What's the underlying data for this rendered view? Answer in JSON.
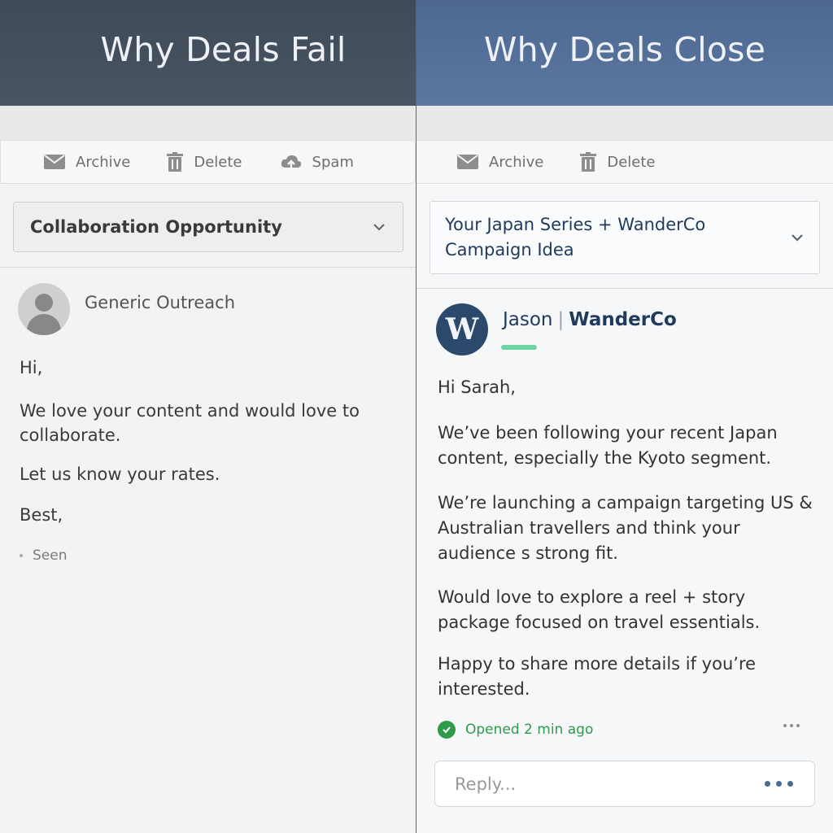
{
  "left": {
    "banner_title": "Why Deals Fail",
    "toolbar": {
      "archive": "Archive",
      "delete": "Delete",
      "spam": "Spam"
    },
    "subject": "Collaboration Opportunity",
    "sender": "Generic Outreach",
    "greeting": "Hi,",
    "paragraphs": [
      "We love your content and would love to collaborate.",
      "Let us know your rates.",
      "Best,"
    ],
    "status": "Seen"
  },
  "right": {
    "banner_title": "Why Deals Close",
    "toolbar": {
      "archive": "Archive",
      "delete": "Delete"
    },
    "subject": "Your Japan Series + WanderCo Campaign Idea",
    "avatar_letter": "W",
    "sender_name": "Jason",
    "sender_company": "WanderCo",
    "greeting": "Hi Sarah,",
    "paragraphs": [
      "We’ve been following your recent Japan content, especially the Kyoto segment.",
      "We’re launching a campaign targeting US & Australian travellers and think your audience s strong fit.",
      "Would love to explore a reel + story package focused on travel essentials.",
      "Happy to share more details if you’re interested."
    ],
    "status": "Opened 2 min ago",
    "reply_placeholder": "Reply..."
  },
  "colors": {
    "left_banner": "#44505e",
    "right_banner": "#55719a",
    "status_green": "#2f9a4a",
    "accent_navy": "#1f3a5c",
    "accent_bar": "#6fd3a8"
  },
  "icons": [
    "envelope-icon",
    "trash-icon",
    "spam-icon",
    "chevron-down-icon",
    "person-icon",
    "check-icon",
    "more-icon"
  ]
}
